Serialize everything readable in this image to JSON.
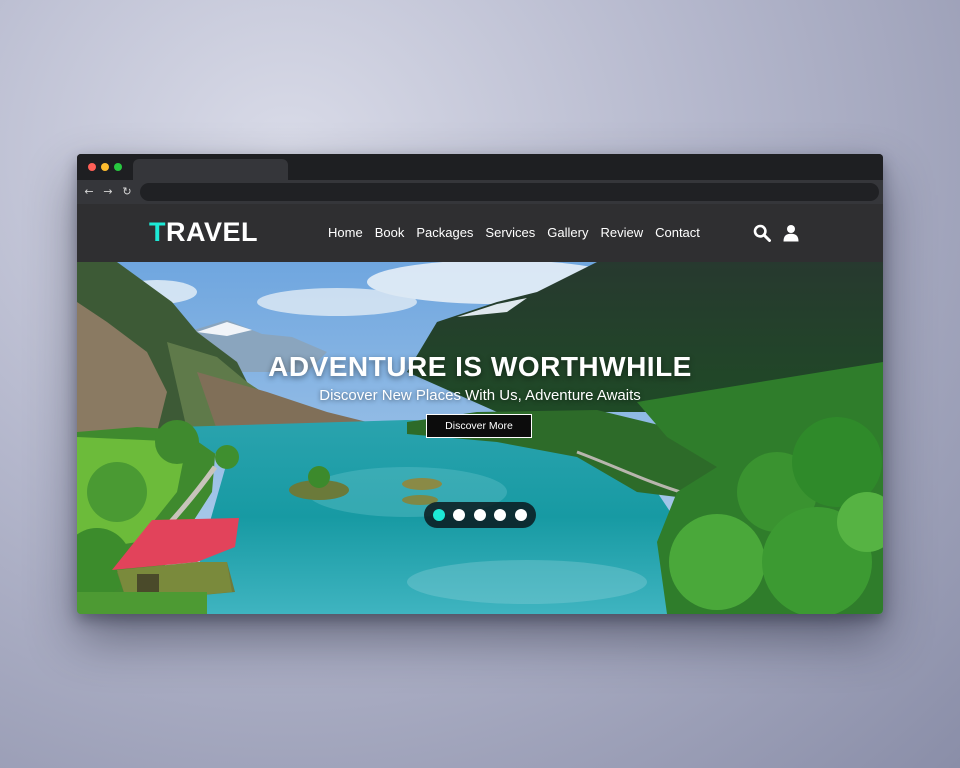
{
  "browser": {
    "back_glyph": "←",
    "forward_glyph": "→",
    "reload_glyph": "↻"
  },
  "site": {
    "logo": {
      "first_letter": "T",
      "rest": "RAVEL"
    },
    "nav": [
      "Home",
      "Book",
      "Packages",
      "Services",
      "Gallery",
      "Review",
      "Contact"
    ],
    "icons": {
      "search": "search-icon",
      "user": "user-icon"
    },
    "colors": {
      "accent": "#1de9d6",
      "header_bg": "#2f2f31"
    }
  },
  "hero": {
    "title": "ADVENTURE IS WORTHWHILE",
    "subtitle": "Discover New Places With Us, Adventure Awaits",
    "button_label": "Discover More",
    "slides_total": 5,
    "active_slide": 1
  }
}
